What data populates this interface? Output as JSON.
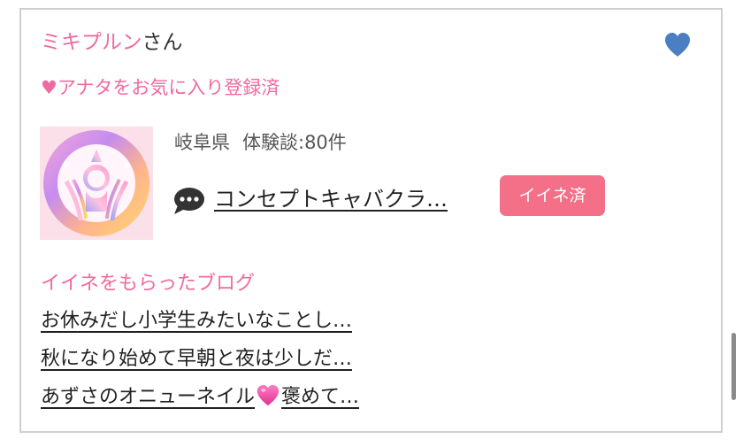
{
  "profile": {
    "name": "ミキプルン",
    "suffix": "さん",
    "favorite_status": "♥アナタをお気に入り登録済",
    "prefecture": "岐阜県",
    "reviews": "体験談:80件",
    "shop_link": "コンセプトキャバクラ…",
    "like_badge": "イイネ済"
  },
  "blogs": {
    "title": "イイネをもらったブログ",
    "items": [
      {
        "before": "お休みだし小学生みたいなことし…",
        "after": ""
      },
      {
        "before": "秋になり始めて早朝と夜は少しだ…",
        "after": ""
      },
      {
        "before": "あずさのオニューネイル",
        "after": "褒めて…"
      }
    ]
  },
  "icons": {
    "favorite": "heart-icon",
    "comment": "speech-bubble-icon",
    "inline_emoji": "pink-heart-emoji"
  },
  "colors": {
    "accent_pink": "#f06aa0",
    "badge_pink": "#f47089",
    "heart_blue": "#4a7fc4",
    "border": "#cfcfcf"
  }
}
